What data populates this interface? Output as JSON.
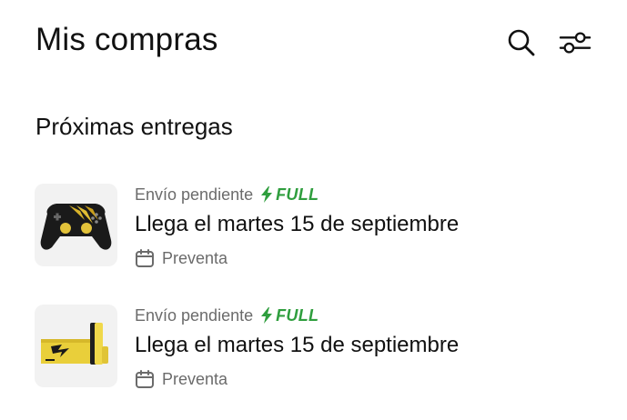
{
  "header": {
    "title": "Mis compras",
    "search_icon": "search-icon",
    "filter_icon": "sliders-icon"
  },
  "section": {
    "title": "Próximas entregas"
  },
  "orders": [
    {
      "status": "Envío pendiente",
      "badge": "FULL",
      "delivery": "Llega el martes 15 de septiembre",
      "tag": "Preventa",
      "thumbnail": "gamepad-controller-black-gold"
    },
    {
      "status": "Envío pendiente",
      "badge": "FULL",
      "delivery": "Llega el martes 15 de septiembre",
      "tag": "Preventa",
      "thumbnail": "console-bundle-yellow"
    }
  ],
  "colors": {
    "badge_green": "#2f9e3e",
    "muted_text": "#6b6b6b",
    "thumb_bg": "#f2f2f2"
  }
}
